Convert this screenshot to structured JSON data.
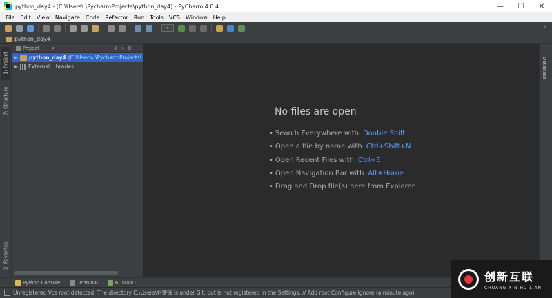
{
  "window": {
    "title": "python_day4 - [C:\\Users\\        \\PycharmProjects\\python_day4] - PyCharm 4.0.4",
    "minimize": "—",
    "maximize": "☐",
    "close": "✕"
  },
  "menu": [
    "File",
    "Edit",
    "View",
    "Navigate",
    "Code",
    "Refactor",
    "Run",
    "Tools",
    "VCS",
    "Window",
    "Help"
  ],
  "breadcrumb": "python_day4",
  "left_tabs": {
    "project": "1: Project",
    "structure": "7: Structure",
    "favorites": "2: Favorites"
  },
  "project_panel": {
    "header": "Project",
    "tree": [
      {
        "name": "python_day4",
        "path": "(C:\\Users\\        \\PycharmProjects\\"
      },
      {
        "name": "External Libraries"
      }
    ]
  },
  "editor": {
    "empty_title": "No files are open",
    "hints": [
      {
        "text": "Search Everywhere with",
        "key": "Double Shift"
      },
      {
        "text": "Open a file by name with",
        "key": "Ctrl+Shift+N"
      },
      {
        "text": "Open Recent Files with",
        "key": "Ctrl+E"
      },
      {
        "text": "Open Navigation Bar with",
        "key": "Alt+Home"
      },
      {
        "text": "Drag and Drop file(s) here from Explorer",
        "key": ""
      }
    ]
  },
  "right_tabs": {
    "database": "Database"
  },
  "bottom_tabs": [
    {
      "label": "Python Console",
      "icon": "python-icon",
      "color": "#e0b84b"
    },
    {
      "label": "Terminal",
      "icon": "terminal-icon",
      "color": "#888888"
    },
    {
      "label": "6: TODO",
      "icon": "todo-icon",
      "color": "#7aa55d"
    }
  ],
  "status": "Unregistered Vcs root detected: The directory C:\\Users\\刘荣锋 is under Git, but is not registered in the Settings. // Add root  Configure  Ignore (a minute ago)",
  "watermark": {
    "cn": "创新互联",
    "en": "CHUANG XIN HU LIAN"
  },
  "colors": {
    "accent": "#589df6",
    "selection": "#2f65ca",
    "folder": "#c6a25a"
  }
}
